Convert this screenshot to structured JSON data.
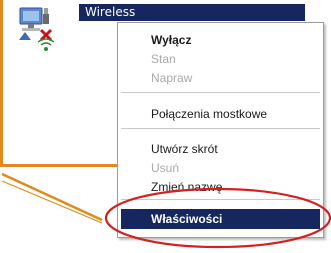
{
  "selected_item": {
    "label": "Wireless",
    "icon": "network-connection-disabled-icon"
  },
  "context_menu": {
    "items": [
      {
        "label": "Wyłącz",
        "state": "enabled"
      },
      {
        "label": "Stan",
        "state": "disabled"
      },
      {
        "label": "Napraw",
        "state": "disabled"
      },
      {
        "label": "Połączenia mostkowe",
        "state": "enabled"
      },
      {
        "label": "Utwórz skrót",
        "state": "enabled"
      },
      {
        "label": "Usuń",
        "state": "disabled"
      },
      {
        "label": "Zmień nazwę",
        "state": "enabled"
      },
      {
        "label": "Właściwości",
        "state": "selected"
      }
    ]
  },
  "colors": {
    "selection": "#16265f",
    "callout": "#e08a1c",
    "highlight_ring": "#d4211f"
  }
}
